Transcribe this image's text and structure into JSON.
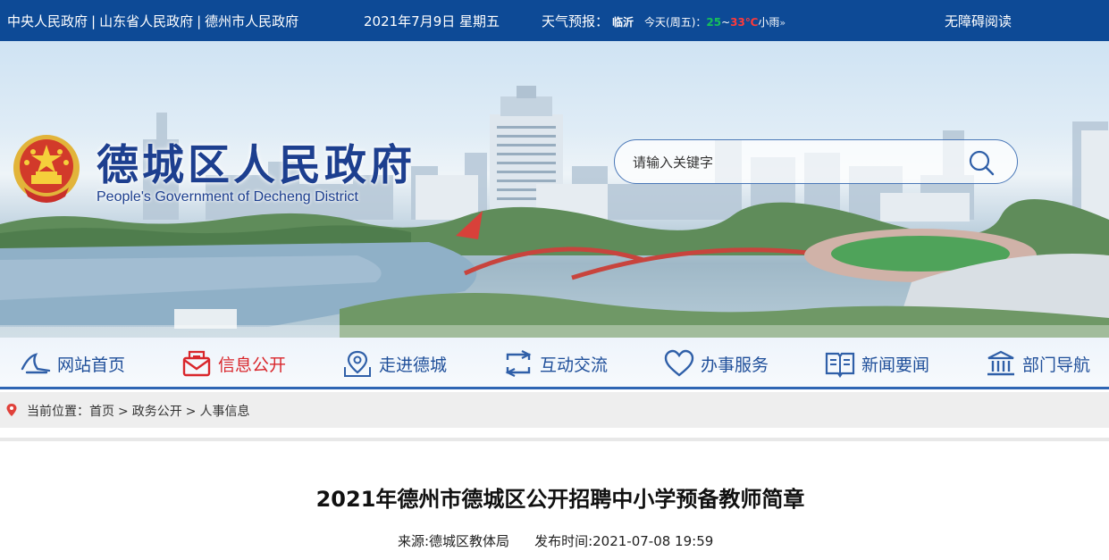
{
  "topbar": {
    "links": [
      "中央人民政府",
      "山东省人民政府",
      "德州市人民政府"
    ],
    "separator": "|",
    "date": "2021年7月9日 星期五",
    "weather": {
      "label": "天气预报：",
      "city": "临沂",
      "today": "今天(周五)：",
      "low": "25",
      "tilde": "~",
      "high": "33℃",
      "condition": "小雨",
      "more": "»"
    },
    "accessibility": "无障碍阅读"
  },
  "header": {
    "title": "德城区人民政府",
    "subtitle": "People's Government of Decheng District",
    "search_placeholder": "请输入关键字"
  },
  "nav": {
    "items": [
      {
        "label": "网站首页",
        "icon": "home-icon"
      },
      {
        "label": "信息公开",
        "icon": "mail-icon"
      },
      {
        "label": "走进德城",
        "icon": "map-pin-icon"
      },
      {
        "label": "互动交流",
        "icon": "exchange-icon"
      },
      {
        "label": "办事服务",
        "icon": "heart-icon"
      },
      {
        "label": "新闻要闻",
        "icon": "book-icon"
      },
      {
        "label": "部门导航",
        "icon": "building-icon"
      }
    ],
    "active_index": 1,
    "colors": {
      "normal": "#1f4f9a",
      "active": "#d9262b",
      "accent": "#2f66b4"
    }
  },
  "breadcrumb": {
    "label": "当前位置：",
    "items": [
      "首页",
      "政务公开",
      "人事信息"
    ],
    "separator": ">"
  },
  "article": {
    "title": "2021年德州市德城区公开招聘中小学预备教师简章",
    "source": "来源:德城区教体局",
    "published": "发布时间:2021-07-08 19:59"
  },
  "colors": {
    "topbar": "#0d4a96",
    "title_blue": "#1d3f8f"
  }
}
